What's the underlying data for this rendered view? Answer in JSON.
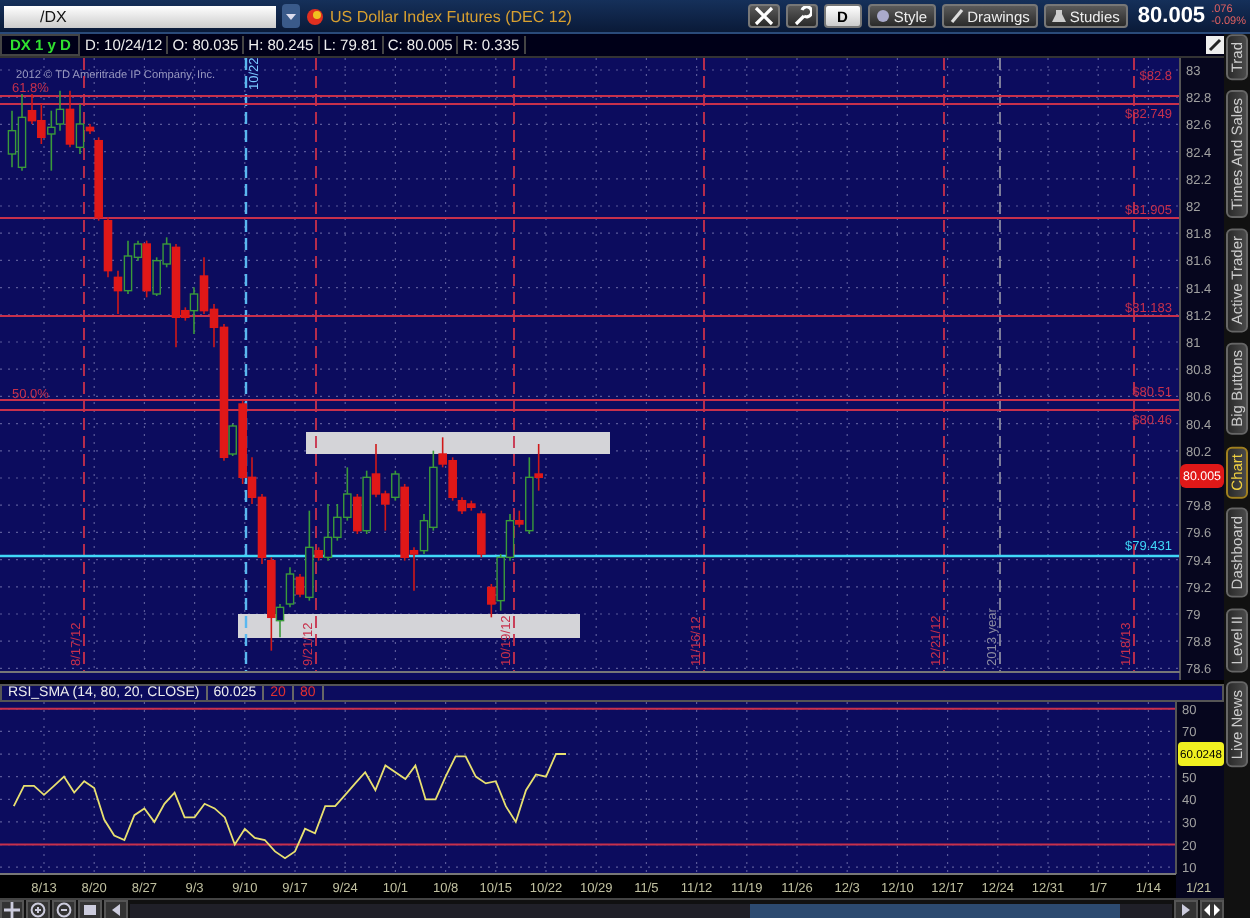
{
  "symbol_field": {
    "value": "/DX"
  },
  "title": "US Dollar Index Futures (DEC 12)",
  "toolbar_buttons": [
    {
      "label": "D",
      "kind": "plain"
    },
    {
      "label": "Style",
      "kind": "style"
    },
    {
      "label": "Drawings",
      "kind": "pencil"
    },
    {
      "label": "Studies",
      "kind": "flask"
    }
  ],
  "last_price": "80.005",
  "change": {
    "net": ".076",
    "percent": "-0.09%"
  },
  "info_bar": {
    "symbol": "DX 1 y D",
    "fields": [
      "D: 10/24/12",
      "O: 80.035",
      "H: 80.245",
      "L: 79.81",
      "C: 80.005",
      "R: 0.335"
    ]
  },
  "price_chart": {
    "copyright": "2012 © TD Ameritrade IP Company, Inc.",
    "axis_labels": [
      "83",
      "82.8",
      "82.6",
      "82.4",
      "82.2",
      "82",
      "81.8",
      "81.6",
      "81.4",
      "81.2",
      "81",
      "80.8",
      "80.6",
      "80.4",
      "80.2",
      "79.8",
      "79.6",
      "79.4",
      "79.2",
      "79",
      "78.8",
      "78.6"
    ],
    "price_badge": "80.005",
    "levels": [
      {
        "label": "$82.8",
        "color": "#c8304c"
      },
      {
        "label": "$82.749",
        "color": "#c8304c"
      },
      {
        "label": "$81.905",
        "color": "#c8304c"
      },
      {
        "label": "$81.183",
        "color": "#c8304c"
      },
      {
        "label": "$80.51",
        "color": "#c8304c"
      },
      {
        "label": "$80.46",
        "color": "#c8304c"
      },
      {
        "label": "$79.431",
        "color": "#40d8f8"
      }
    ],
    "fib_labels": [
      "61.8%",
      "50.0%"
    ],
    "date_markers": [
      {
        "label": "8/17/12",
        "kind": "period"
      },
      {
        "label": "10/22",
        "kind": "current"
      },
      {
        "label": "9/21/12",
        "kind": "period"
      },
      {
        "label": "10/19/12",
        "kind": "period"
      },
      {
        "label": "11/16/12",
        "kind": "period"
      },
      {
        "label": "12/21/12",
        "kind": "period"
      },
      {
        "label": "2013 year",
        "kind": "year"
      },
      {
        "label": "1/18/13",
        "kind": "period"
      }
    ]
  },
  "rsi": {
    "study": "RSI_SMA (14, 80, 20, CLOSE)",
    "value": "60.025",
    "params": [
      "20",
      "80"
    ],
    "badge": "60.0248",
    "chart_data": {
      "type": "line",
      "series": [
        {
          "color": "#e8e070",
          "values": [
            37,
            46,
            46,
            42,
            46,
            50,
            43,
            48,
            45,
            31,
            24,
            22,
            33,
            36,
            30,
            38,
            43,
            32,
            32,
            38,
            36,
            32,
            20,
            27,
            23,
            22,
            17,
            14,
            17,
            27,
            25,
            37,
            37,
            42,
            47,
            52,
            44,
            55,
            52,
            49,
            55,
            40,
            40,
            50,
            59,
            59,
            50,
            47,
            48,
            37,
            30,
            44,
            51,
            50,
            60,
            60,
            null,
            null,
            null,
            null,
            null,
            null,
            null,
            null,
            null,
            null,
            null,
            null,
            null,
            null,
            null,
            null,
            null,
            null,
            null,
            null,
            null,
            null,
            null,
            null,
            null,
            null,
            null,
            null,
            null,
            null,
            null,
            null,
            null,
            null,
            null,
            null,
            null,
            null,
            null,
            null,
            null,
            null,
            null,
            null,
            null,
            null,
            null,
            null,
            null,
            null,
            null,
            null,
            null,
            null,
            null,
            null,
            null,
            null,
            null,
            null,
            null,
            null,
            null
          ]
        }
      ],
      "ylim": [
        7,
        83
      ],
      "yticks": [
        80,
        70,
        50,
        40,
        30,
        20,
        10
      ],
      "grid": true,
      "categories": [
        null,
        null,
        null,
        "8/13",
        null,
        null,
        null,
        null,
        "8/20",
        null,
        null,
        null,
        null,
        "8/27",
        null,
        null,
        null,
        null,
        "9/3",
        null,
        null,
        null,
        null,
        "9/10",
        null,
        null,
        null,
        null,
        "9/17",
        null,
        null,
        null,
        null,
        "9/24",
        null,
        null,
        null,
        null,
        "10/1",
        null,
        null,
        null,
        null,
        "10/8",
        null,
        null,
        null,
        null,
        "10/15",
        null,
        null,
        null,
        null,
        "10/22",
        null,
        null,
        null,
        null,
        "10/29",
        null,
        null,
        null,
        null,
        "11/5",
        null,
        null,
        null,
        null,
        "11/12",
        null,
        null,
        null,
        null,
        "11/19",
        null,
        null,
        null,
        null,
        "11/26",
        null,
        null,
        null,
        null,
        "12/3",
        null,
        null,
        null,
        null,
        "12/10",
        null,
        null,
        null,
        null,
        "12/17",
        null,
        null,
        null,
        null,
        "12/24",
        null,
        null,
        null,
        null,
        "12/31",
        null,
        null,
        null,
        null,
        "1/7",
        null,
        null,
        null,
        null,
        "1/14",
        null,
        null,
        null,
        null,
        "1/21"
      ]
    }
  },
  "side_tabs": [
    {
      "label": "Trad",
      "selected": false
    },
    {
      "label": "Times And Sales",
      "selected": false
    },
    {
      "label": "Active Trader",
      "selected": false
    },
    {
      "label": "Big Buttons",
      "selected": false
    },
    {
      "label": "Chart",
      "selected": true
    },
    {
      "label": "Dashboard",
      "selected": false
    },
    {
      "label": "Level II",
      "selected": false
    },
    {
      "label": "Live News",
      "selected": false
    }
  ]
}
